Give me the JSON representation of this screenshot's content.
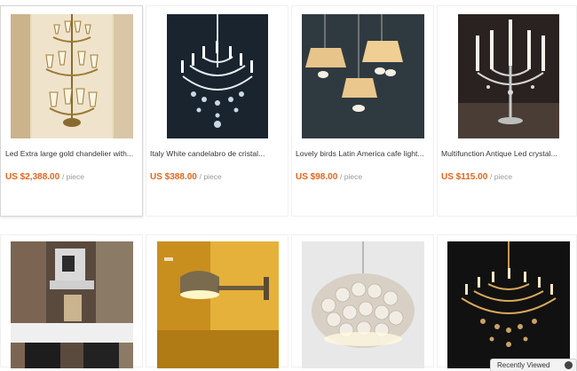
{
  "products": [
    {
      "title": "Led Extra large gold chandelier with...",
      "price": "US $2,388.00",
      "unit": "/ piece",
      "image": "gold-chandelier-photo"
    },
    {
      "title": "Italy White candelabro de cristal...",
      "price": "US $388.00",
      "unit": "/ piece",
      "image": "crystal-chandelier-photo"
    },
    {
      "title": "Lovely birds Latin America cafe light...",
      "price": "US $98.00",
      "unit": "/ piece",
      "image": "bird-pendant-lights-photo"
    },
    {
      "title": "Multifunction Antique Led crystal...",
      "price": "US $115.00",
      "unit": "/ piece",
      "image": "candle-candelabra-photo"
    },
    {
      "image": "restaurant-interior-photo"
    },
    {
      "image": "swing-arm-wall-lamp-photo"
    },
    {
      "image": "acrylic-ball-pendant-photo"
    },
    {
      "image": "amber-crystal-chandelier-photo"
    }
  ],
  "recently_viewed": {
    "label": "Recently Viewed",
    "icon": "arrow-circle-icon"
  },
  "colors": {
    "price": "#e8641c",
    "unit": "#999999"
  }
}
